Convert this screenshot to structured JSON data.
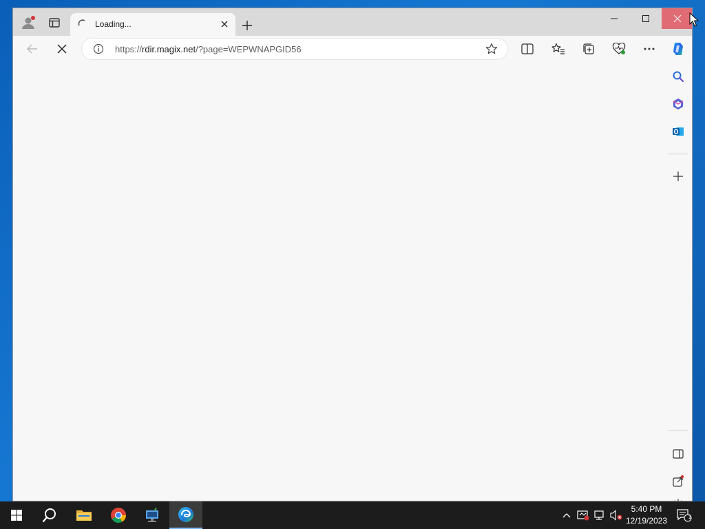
{
  "browser": {
    "tab": {
      "title": "Loading..."
    },
    "address": {
      "scheme": "https://",
      "host": "rdir.magix.net",
      "path": "/?page=WEPWNAPGID56"
    }
  },
  "taskbar": {
    "time": "5:40 PM",
    "date": "12/19/2023",
    "notification_count": "1",
    "apps": [
      "start-icon",
      "search-icon",
      "file-explorer-icon",
      "chrome-icon",
      "network-app-icon",
      "edge-icon"
    ]
  },
  "colors": {
    "accent": "#1976d2",
    "close_hover": "#e81123",
    "badge": "#d13438"
  }
}
